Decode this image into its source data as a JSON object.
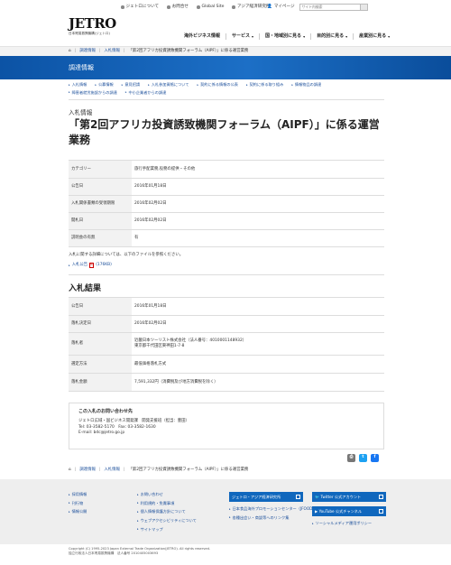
{
  "header": {
    "util_links": [
      "ジェトロについて",
      "お問合せ",
      "Global Site",
      "アジア経済研究所"
    ],
    "mypage": "マイページ",
    "search_placeholder": "サイト内検索",
    "logo_word": "JETRO",
    "logo_sub": "日本貿易振興機構(ジェトロ)",
    "gnav": [
      "海外ビジネス情報",
      "サービス",
      "国・地域別に見る",
      "目的別に見る",
      "産業別に見る"
    ]
  },
  "breadcrumb": [
    "調達情報",
    "入札情報",
    "「第2回アフリカ投資誘致機関フォーラム（AIPF）」に係る運営業務"
  ],
  "banner": {
    "title": "調達情報"
  },
  "subnav": {
    "row1": [
      "入札情報",
      "公募情報",
      "意見招請",
      "入札参加資格について",
      "契約に係る情報の公表",
      "契約に係る取り組み",
      "情報物品の調達"
    ],
    "row2": [
      "障害者就労施設からの調達",
      "中小企業者からの調達"
    ]
  },
  "page": {
    "kind": "入札情報",
    "title": "「第2回アフリカ投資誘致機関フォーラム（AIPF）」に係る運営業務"
  },
  "info_table": [
    {
      "label": "カテゴリー",
      "value": "旅行手配業務,役務の提供・その他"
    },
    {
      "label": "公告日",
      "value": "2016年01月18日"
    },
    {
      "label": "入札関係書類の受領期限",
      "value": "2016年02月02日"
    },
    {
      "label": "開札日",
      "value": "2016年02月02日"
    },
    {
      "label": "説明会の有無",
      "value": "有"
    }
  ],
  "note": "入札に関する詳細については、以下のファイルを参照ください。",
  "pdf_link": "入札公告",
  "pdf_size": "(176KB)",
  "result_heading": "入札結果",
  "result_table": [
    {
      "label": "公告日",
      "value": "2016年01月18日"
    },
    {
      "label": "落札決定日",
      "value": "2016年02月02日"
    },
    {
      "label": "落札者",
      "value": "近畿日本ツーリスト株式会社（法人番号：4010001148932）\n東京都千代田区東神田1-7-8"
    },
    {
      "label": "選定方法",
      "value": "最低価格落札方式"
    },
    {
      "label": "落札金額",
      "value": "7,591,332円（消費税及び地方消費税を除く）"
    }
  ],
  "contact": {
    "title": "この入札のお問い合わせ先",
    "dept": "ジェトロ広域・国ビジネス開発課　開発支援班（担当：豊田）",
    "tel": "Tel: 03-3582-5170　Fax: 03-3582-1630",
    "email": "E-mail: bdc@jetro.go.jp"
  },
  "share": {
    "print": "⎙",
    "twitter": "t",
    "facebook": "f"
  },
  "footer": {
    "col1": [
      "採用情報",
      "刊行物",
      "情報公開"
    ],
    "col2": [
      "お問い合わせ",
      "利用規約・免責事項",
      "個人情報保護方針について",
      "ウェブアクセシビリティについて",
      "サイトマップ"
    ],
    "col3_btn": "ジェトロ・アジア経済研究所",
    "col3_links": [
      "日本食品海外プロモーションセンター（JFOODO）",
      "各種出会い・商談等へのリンク集"
    ],
    "col4_btns": [
      "Twitter 公式アカウント",
      "YouTube 公式チャンネル"
    ],
    "col4_link": "ソーシャルメディア運用ポリシー"
  },
  "copyright": [
    "Copyright (C) 1995-2023 Japan External Trade Organization(JETRO). All rights reserved.",
    "独立行政法人日本貿易振興機構　法人番号 2010405003693"
  ],
  "colors": {
    "brand_blue": "#0c53a5",
    "link": "#1a4e9a",
    "twitter": "#1da1f2",
    "facebook": "#1877f2",
    "youtube_btn": "#1067bd"
  }
}
